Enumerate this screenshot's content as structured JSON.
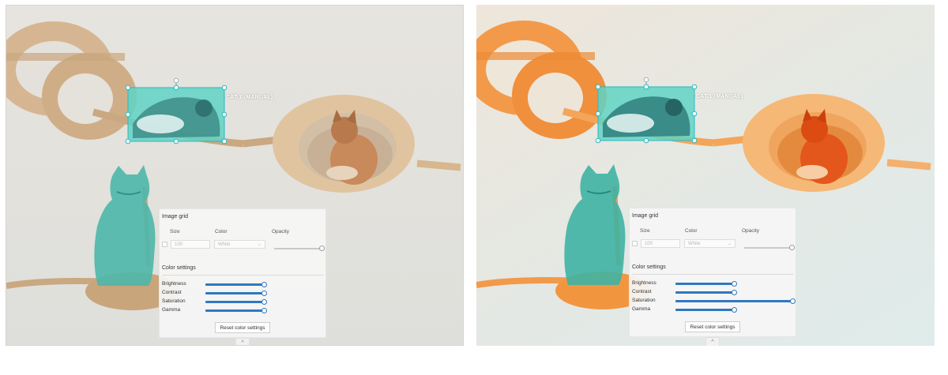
{
  "screenshots": [
    {
      "id": "left",
      "filter": "neutral",
      "annotation_label": "CAT 1 (MANUAL)",
      "panel": {
        "section_image_grid": "Image grid",
        "size_label": "Size",
        "size_value": "100",
        "color_label": "Color",
        "color_value": "White",
        "opacity_label": "Opacity",
        "section_color_settings": "Color settings",
        "sliders": [
          {
            "label": "Brightness",
            "value": 0.5
          },
          {
            "label": "Contrast",
            "value": 0.5
          },
          {
            "label": "Saturation",
            "value": 0.5
          },
          {
            "label": "Gamma",
            "value": 0.5
          }
        ],
        "reset_label": "Reset color settings"
      },
      "collapse_icon": "^"
    },
    {
      "id": "right",
      "filter": "warm-saturated",
      "annotation_label": "CAT 1 (MANUAL)",
      "panel": {
        "section_image_grid": "Image grid",
        "size_label": "Size",
        "size_value": "100",
        "color_label": "Color",
        "color_value": "White",
        "opacity_label": "Opacity",
        "section_color_settings": "Color settings",
        "sliders": [
          {
            "label": "Brightness",
            "value": 0.5
          },
          {
            "label": "Contrast",
            "value": 0.5
          },
          {
            "label": "Saturation",
            "value": 1.0
          },
          {
            "label": "Gamma",
            "value": 0.5
          }
        ],
        "reset_label": "Reset color settings"
      },
      "collapse_icon": "^"
    }
  ],
  "colors": {
    "annotation_fill": "#5fd3c4",
    "annotation_handle": "#2bb7c3",
    "slider_accent": "#2f78c0"
  }
}
